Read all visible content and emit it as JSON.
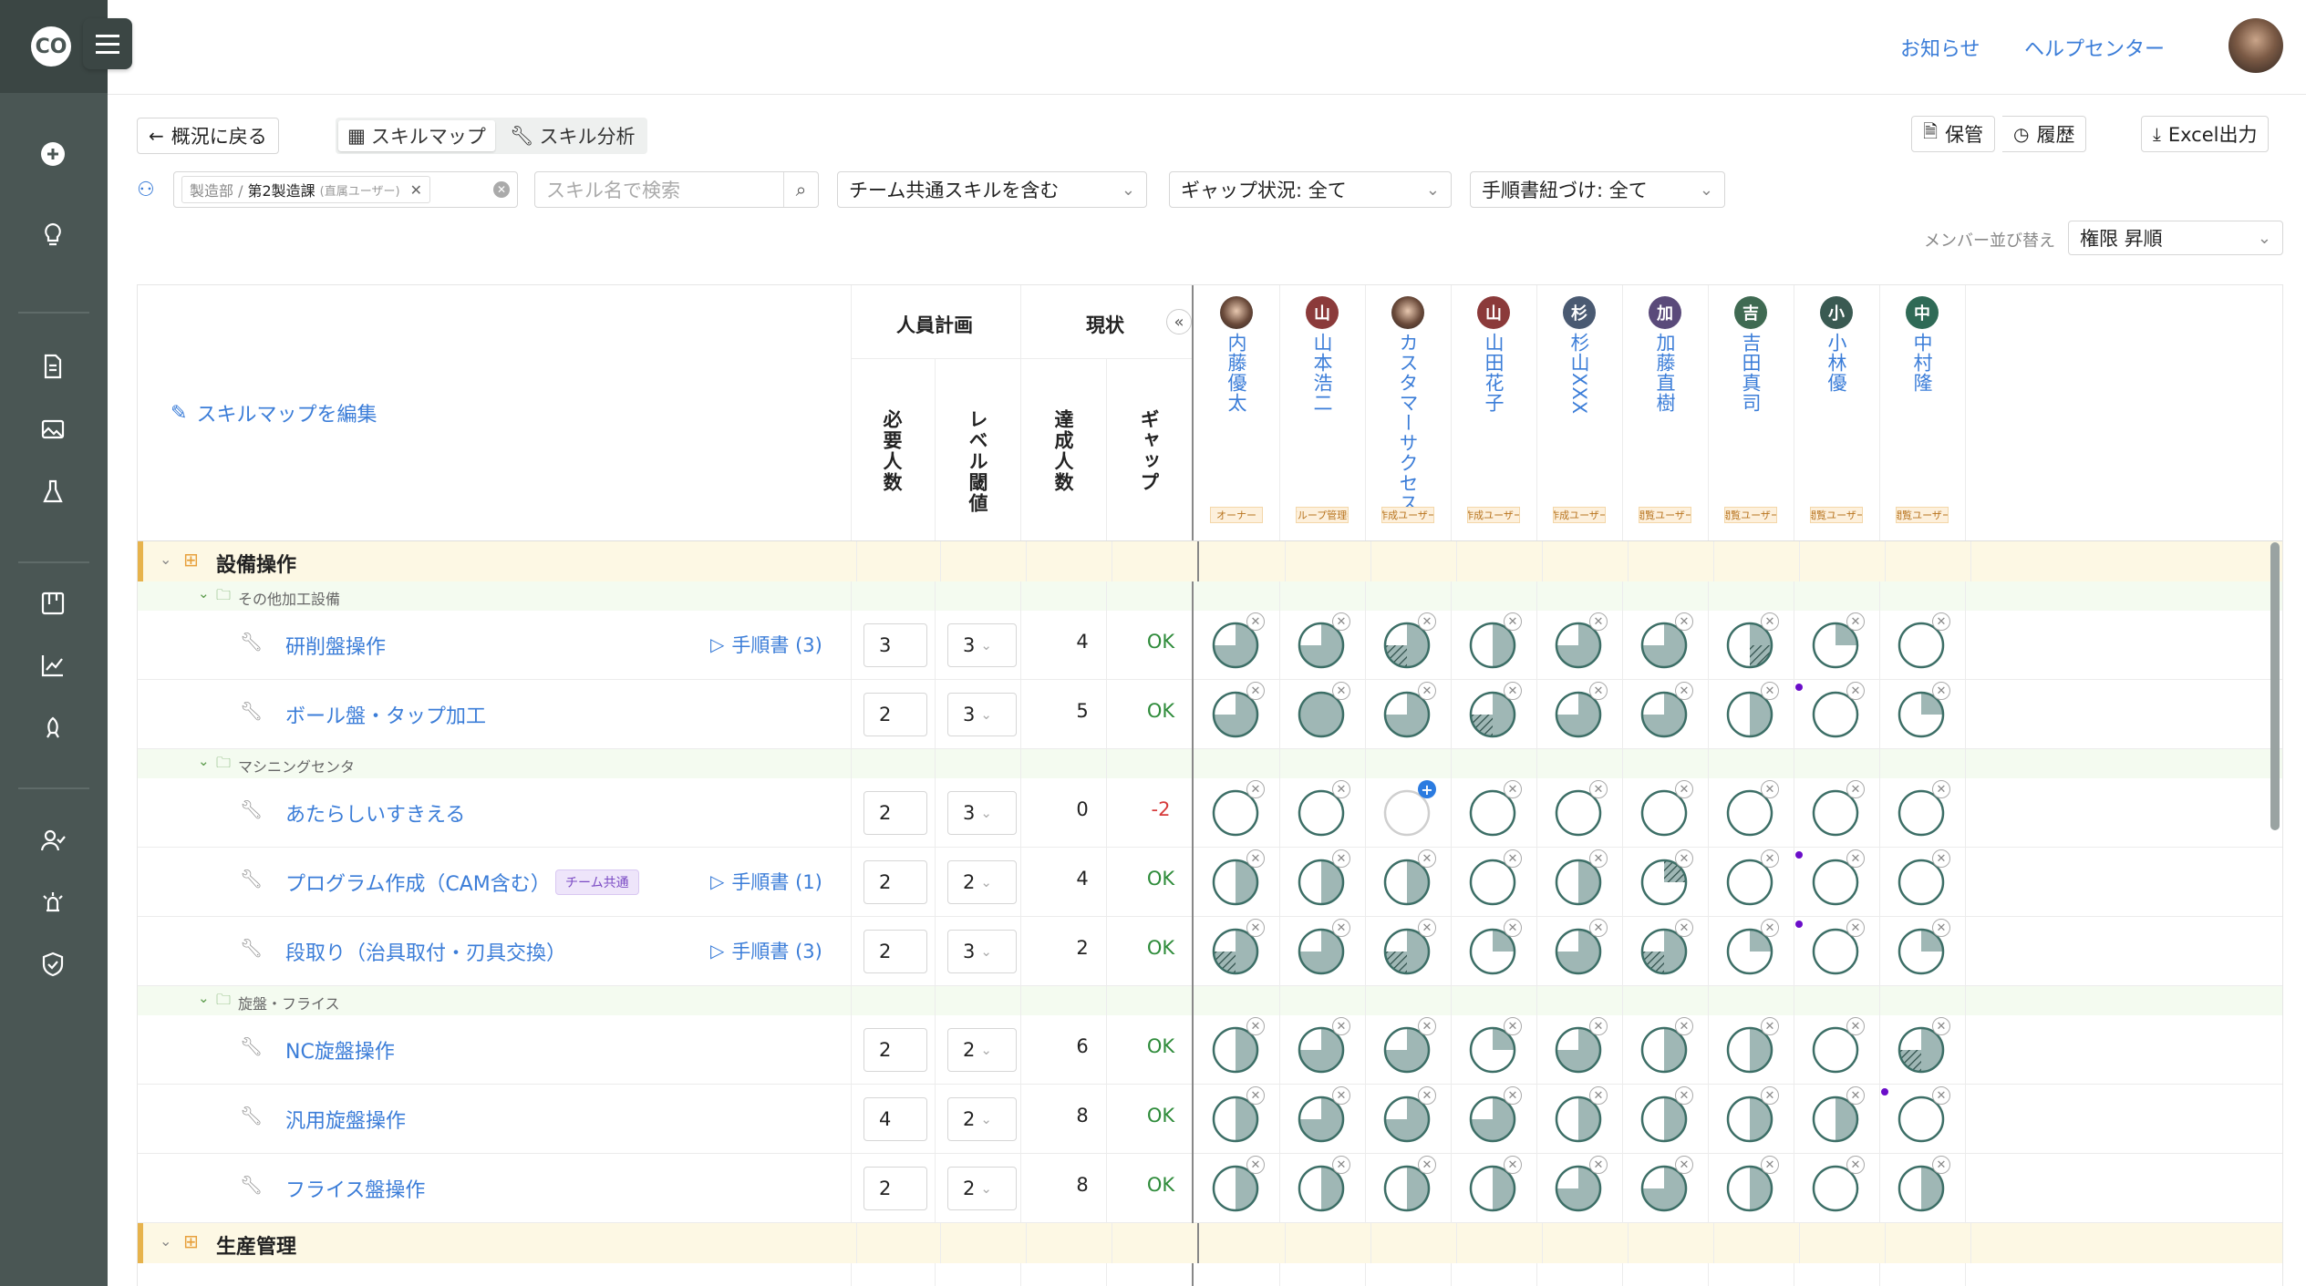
{
  "topbar": {
    "news": "お知らせ",
    "help": "ヘルプセンター"
  },
  "toolbar": {
    "back": "概況に戻る",
    "tab_map": "スキルマップ",
    "tab_analysis": "スキル分析",
    "save": "保管",
    "history": "履歴",
    "excel": "Excel出力"
  },
  "filters": {
    "dept_prefix": "製造部 /",
    "dept_name": "第2製造課",
    "dept_note": "(直属ユーザー)",
    "search_placeholder": "スキル名で検索",
    "team_skill": "チーム共通スキルを含む",
    "gap_status": "ギャップ状況: 全て",
    "manual_link": "手順書紐づけ: 全て",
    "sort_label": "メンバー並び替え",
    "sort_value": "権限 昇順"
  },
  "header": {
    "edit_map": "スキルマップを編集",
    "plan": "人員計画",
    "current": "現状",
    "required": "必要人数",
    "level": "レベル閾値",
    "achieved": "達成人数",
    "gap": "ギャップ",
    "collapse": "«"
  },
  "members": [
    {
      "initial": "",
      "name": "内藤優太",
      "role": "オーナー",
      "color": "#8a6a55"
    },
    {
      "initial": "山",
      "name": "山本浩二",
      "role": "グループ管理者",
      "color": "#8b3a3a"
    },
    {
      "initial": "",
      "name": "カスタマーサクセス",
      "role": "作成ユーザー",
      "color": "#555"
    },
    {
      "initial": "山",
      "name": "山田花子",
      "role": "作成ユーザー",
      "color": "#8b3a3a"
    },
    {
      "initial": "杉",
      "name": "杉山XXX",
      "role": "作成ユーザー",
      "color": "#4a5a72"
    },
    {
      "initial": "加",
      "name": "加藤直樹",
      "role": "閲覧ユーザー",
      "color": "#5a4a7a"
    },
    {
      "initial": "吉",
      "name": "吉田真司",
      "role": "閲覧ユーザー",
      "color": "#3f6a52"
    },
    {
      "initial": "小",
      "name": "小林優",
      "role": "閲覧ユーザー",
      "color": "#3a5a52"
    },
    {
      "initial": "中",
      "name": "中村隆",
      "role": "閲覧ユーザー",
      "color": "#2f6a56"
    }
  ],
  "groups": [
    {
      "name": "設備操作",
      "subgroups": [
        {
          "name": "その他加工設備",
          "skills": [
            {
              "name": "研削盤操作",
              "badge": "",
              "manual": "手順書 (3)",
              "required": "3",
              "level": "3",
              "achieved": "4",
              "gap": "OK",
              "levels": [
                3,
                3,
                "h3",
                2,
                3,
                3,
                "h2",
                1,
                0
              ],
              "dots": []
            },
            {
              "name": "ボール盤・タップ加工",
              "badge": "",
              "manual": "",
              "required": "2",
              "level": "3",
              "achieved": "5",
              "gap": "OK",
              "levels": [
                3,
                4,
                3,
                "h3",
                3,
                3,
                2,
                0,
                1
              ],
              "dots": [
                7
              ]
            }
          ]
        },
        {
          "name": "マシニングセンタ",
          "skills": [
            {
              "name": "あたらしいすきえる",
              "badge": "",
              "manual": "",
              "required": "2",
              "level": "3",
              "achieved": "0",
              "gap": "-2",
              "levels": [
                0,
                0,
                "plus",
                0,
                0,
                0,
                0,
                0,
                0
              ],
              "dots": []
            },
            {
              "name": "プログラム作成（CAM含む）",
              "badge": "チーム共通",
              "manual": "手順書 (1)",
              "required": "2",
              "level": "2",
              "achieved": "4",
              "gap": "OK",
              "levels": [
                2,
                2,
                2,
                0,
                2,
                "h1",
                0,
                0,
                0
              ],
              "dots": [
                7
              ]
            },
            {
              "name": "段取り（治具取付・刃具交換）",
              "badge": "",
              "manual": "手順書 (3)",
              "required": "2",
              "level": "3",
              "achieved": "2",
              "gap": "OK",
              "levels": [
                "h3",
                3,
                "h3",
                1,
                3,
                "h3",
                1,
                0,
                1
              ],
              "dots": [
                7
              ]
            }
          ]
        },
        {
          "name": "旋盤・フライス",
          "skills": [
            {
              "name": "NC旋盤操作",
              "badge": "",
              "manual": "",
              "required": "2",
              "level": "2",
              "achieved": "6",
              "gap": "OK",
              "levels": [
                2,
                3,
                3,
                1,
                3,
                2,
                2,
                0,
                "h3"
              ],
              "dots": []
            },
            {
              "name": "汎用旋盤操作",
              "badge": "",
              "manual": "",
              "required": "4",
              "level": "2",
              "achieved": "8",
              "gap": "OK",
              "levels": [
                2,
                3,
                3,
                3,
                2,
                2,
                2,
                2,
                0
              ],
              "dots": [
                8
              ]
            },
            {
              "name": "フライス盤操作",
              "badge": "",
              "manual": "",
              "required": "2",
              "level": "2",
              "achieved": "8",
              "gap": "OK",
              "levels": [
                2,
                2,
                2,
                2,
                3,
                3,
                2,
                0,
                2
              ],
              "dots": []
            }
          ]
        }
      ]
    },
    {
      "name": "生産管理",
      "subgroups": []
    }
  ],
  "colors": {
    "accent": "#3b7dd8",
    "fill": "#9fb7b5",
    "ring": "#3c6e66",
    "ok": "#2e8b3a",
    "neg": "#d63a3a"
  }
}
